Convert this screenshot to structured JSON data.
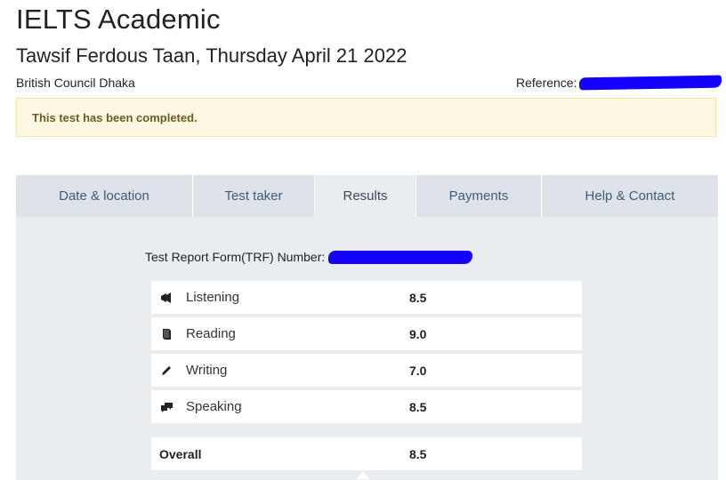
{
  "header": {
    "title": "IELTS Academic",
    "subtitle": "Tawsif Ferdous Taan, Thursday April 21 2022",
    "centre": "British Council Dhaka",
    "reference_label": "Reference:"
  },
  "notice": {
    "text": "This test has been completed."
  },
  "tabs": [
    {
      "label": "Date & location",
      "active": false
    },
    {
      "label": "Test taker",
      "active": false
    },
    {
      "label": "Results",
      "active": true
    },
    {
      "label": "Payments",
      "active": false
    },
    {
      "label": "Help & Contact",
      "active": false
    }
  ],
  "results": {
    "trf_label": "Test Report Form(TRF) Number:",
    "modules": [
      {
        "name": "Listening",
        "icon": "megaphone-icon",
        "score": "8.5"
      },
      {
        "name": "Reading",
        "icon": "book-icon",
        "score": "9.0"
      },
      {
        "name": "Writing",
        "icon": "pencil-icon",
        "score": "7.0"
      },
      {
        "name": "Speaking",
        "icon": "speech-bubbles-icon",
        "score": "8.5"
      }
    ],
    "overall": {
      "label": "Overall",
      "score": "8.5"
    }
  },
  "colors": {
    "redaction": "#1300ff",
    "notice_bg": "#fcf8e3",
    "panel_bg": "#e9edf0",
    "tab_text": "#3d5c76"
  }
}
